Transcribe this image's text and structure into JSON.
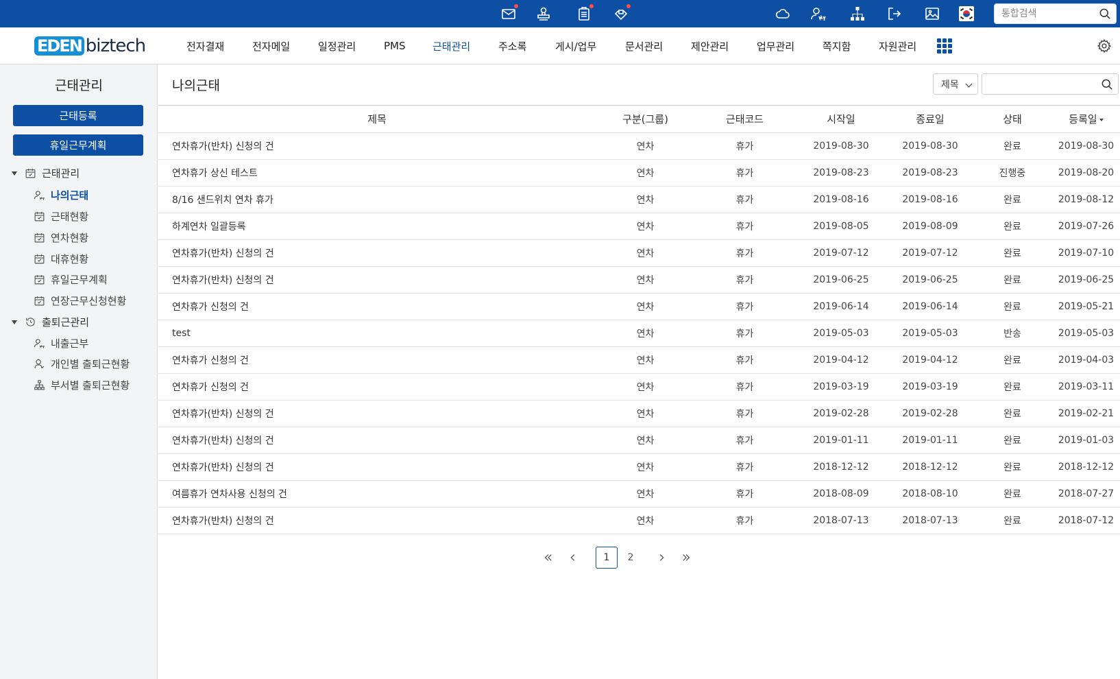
{
  "brand": {
    "logo_mark": "EDEN",
    "logo_text": "biztech"
  },
  "colors": {
    "brand_blue": "#0c4fa3",
    "logo_blue": "#1590d6",
    "notification_dot": "#ff4d4d"
  },
  "topbar": {
    "icons": [
      "mail-icon",
      "approval-stamp-icon",
      "clipboard-icon",
      "share-icon",
      "cloud-icon",
      "my-user-icon",
      "org-chart-icon",
      "logout-icon",
      "image-icon",
      "korea-flag-icon"
    ],
    "search_placeholder": "통합검색"
  },
  "nav": {
    "menus": [
      "전자결재",
      "전자메일",
      "일정관리",
      "PMS",
      "근태관리",
      "주소록",
      "게시/업무",
      "문서관리",
      "제안관리",
      "업무관리",
      "쪽지함",
      "자원관리"
    ],
    "active": "근태관리"
  },
  "sidebar": {
    "title": "근태관리",
    "buttons": [
      "근태등록",
      "휴일근무계획"
    ],
    "groups": [
      {
        "label": "근태관리",
        "items": [
          "나의근태",
          "근태현황",
          "연차현황",
          "대휴현황",
          "휴일근무계획",
          "연장근무신청현황"
        ]
      },
      {
        "label": "출퇴근관리",
        "items": [
          "내출근부",
          "개인별 출퇴근현황",
          "부서별 출퇴근현황"
        ]
      }
    ],
    "active_item": "나의근태"
  },
  "main": {
    "title": "나의근태",
    "search_field": "제목",
    "search_value": ""
  },
  "table": {
    "columns": [
      "제목",
      "구분(그룹)",
      "근태코드",
      "시작일",
      "종료일",
      "상태",
      "등록일"
    ],
    "sorted_column": "등록일",
    "rows": [
      [
        "연차휴가(반차) 신청의 건",
        "연차",
        "휴가",
        "2019-08-30",
        "2019-08-30",
        "완료",
        "2019-08-30"
      ],
      [
        "연차휴가 상신 테스트",
        "연차",
        "휴가",
        "2019-08-23",
        "2019-08-23",
        "진행중",
        "2019-08-20"
      ],
      [
        "8/16 샌드위치 연차 휴가",
        "연차",
        "휴가",
        "2019-08-16",
        "2019-08-16",
        "완료",
        "2019-08-12"
      ],
      [
        "하계연차 일괄등록",
        "연차",
        "휴가",
        "2019-08-05",
        "2019-08-09",
        "완료",
        "2019-07-26"
      ],
      [
        "연차휴가(반차) 신청의 건",
        "연차",
        "휴가",
        "2019-07-12",
        "2019-07-12",
        "완료",
        "2019-07-10"
      ],
      [
        "연차휴가(반차) 신청의 건",
        "연차",
        "휴가",
        "2019-06-25",
        "2019-06-25",
        "완료",
        "2019-06-25"
      ],
      [
        "연차휴가 신청의 건",
        "연차",
        "휴가",
        "2019-06-14",
        "2019-06-14",
        "완료",
        "2019-05-21"
      ],
      [
        "test",
        "연차",
        "휴가",
        "2019-05-03",
        "2019-05-03",
        "반송",
        "2019-05-03"
      ],
      [
        "연차휴가 신청의 건",
        "연차",
        "휴가",
        "2019-04-12",
        "2019-04-12",
        "완료",
        "2019-04-03"
      ],
      [
        "연차휴가 신청의 건",
        "연차",
        "휴가",
        "2019-03-19",
        "2019-03-19",
        "완료",
        "2019-03-11"
      ],
      [
        "연차휴가(반차) 신청의 건",
        "연차",
        "휴가",
        "2019-02-28",
        "2019-02-28",
        "완료",
        "2019-02-21"
      ],
      [
        "연차휴가(반차) 신청의 건",
        "연차",
        "휴가",
        "2019-01-11",
        "2019-01-11",
        "완료",
        "2019-01-03"
      ],
      [
        "연차휴가(반차) 신청의 건",
        "연차",
        "휴가",
        "2018-12-12",
        "2018-12-12",
        "완료",
        "2018-12-12"
      ],
      [
        "여름휴가 연차사용 신청의 건",
        "연차",
        "휴가",
        "2018-08-09",
        "2018-08-10",
        "완료",
        "2018-07-27"
      ],
      [
        "연차휴가(반차) 신청의 건",
        "연차",
        "휴가",
        "2018-07-13",
        "2018-07-13",
        "완료",
        "2018-07-12"
      ]
    ]
  },
  "pagination": {
    "pages": [
      "1",
      "2"
    ],
    "current": "1"
  }
}
